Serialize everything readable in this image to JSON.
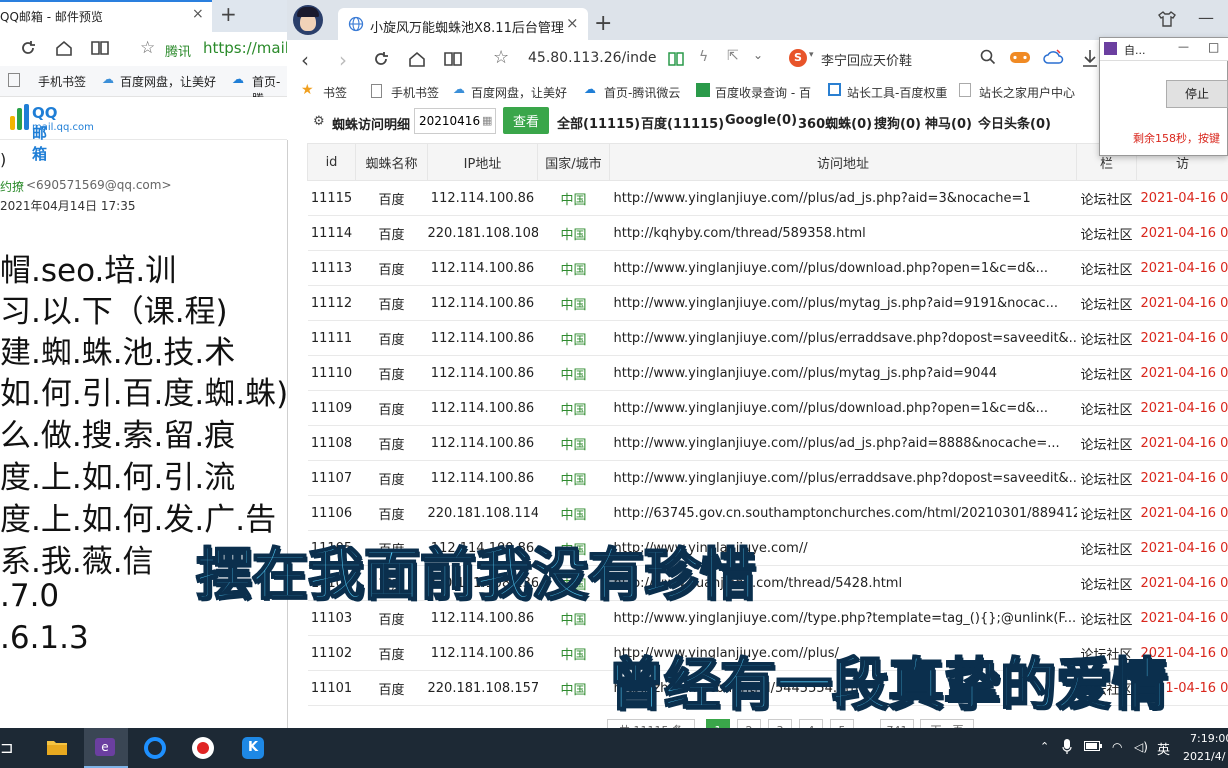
{
  "left_browser": {
    "tab_title": "QQ邮箱 - 邮件预览",
    "tab_close": "×",
    "new_tab": "+",
    "address_site": "腾讯",
    "address_url": "https://mail.q",
    "bookmarks": [
      "手机书签",
      "百度网盘，让美好",
      "首页-腾"
    ],
    "mail_logo_text": "QQ邮箱",
    "mail_logo_domain": "mail.qq.com",
    "sender_paren": ")",
    "sender_name": "约撩",
    "sender_email": "<690571569@qq.com>",
    "sent_time": "2021年04月14日 17:35",
    "body_lines": [
      "帽.seo.培.训",
      "习.以.下（课.程)",
      "建.蜘.蛛.池.技.术",
      "如.何.引.百.度.蜘.蛛)",
      "么.做.搜.索.留.痕",
      "度.上.如.何.引.流",
      "度.上.如.何.发.广.告",
      "系.我.薇.信",
      ".7.0",
      ".6.1.3"
    ]
  },
  "right_browser": {
    "tab_title": "小旋风万能蜘蛛池X8.11后台管理",
    "tab_close": "×",
    "new_tab": "+",
    "address": "45.80.113.26/inde",
    "search_text": "李宁回应天价鞋",
    "bookmarks": [
      "书签",
      "手机书签",
      "百度网盘，让美好",
      "首页-腾讯微云",
      "百度收录查询 - 百",
      "站长工具-百度权重",
      "站长之家用户中心"
    ]
  },
  "toolbar": {
    "title": "蜘蛛访问明细",
    "date_value": "20210416",
    "search_label": "查看",
    "filters": [
      "全部(11115)",
      "百度(11115)",
      "Google(0)",
      "360蜘蛛(0)",
      "搜狗(0)",
      "神马(0)",
      "今日头条(0)"
    ]
  },
  "table": {
    "headers": [
      "id",
      "蜘蛛名称",
      "IP地址",
      "国家/城市",
      "访问地址",
      "栏",
      "访"
    ],
    "rows": [
      {
        "id": "11115",
        "name": "百度",
        "ip": "112.114.100.86",
        "country": "中国",
        "url": "http://www.yinglanjiuye.com//plus/ad_js.php?aid=3&nocache=1",
        "type": "论坛社区",
        "time": "2021-04-16 07"
      },
      {
        "id": "11114",
        "name": "百度",
        "ip": "220.181.108.108",
        "country": "中国",
        "url": "http://kqhyby.com/thread/589358.html",
        "type": "论坛社区",
        "time": "2021-04-16 07"
      },
      {
        "id": "11113",
        "name": "百度",
        "ip": "112.114.100.86",
        "country": "中国",
        "url": "http://www.yinglanjiuye.com//plus/download.php?open=1&c=d&...",
        "type": "论坛社区",
        "time": "2021-04-16 07"
      },
      {
        "id": "11112",
        "name": "百度",
        "ip": "112.114.100.86",
        "country": "中国",
        "url": "http://www.yinglanjiuye.com//plus/mytag_js.php?aid=9191&nocac...",
        "type": "论坛社区",
        "time": "2021-04-16 07"
      },
      {
        "id": "11111",
        "name": "百度",
        "ip": "112.114.100.86",
        "country": "中国",
        "url": "http://www.yinglanjiuye.com//plus/erraddsave.php?dopost=saveedit&...",
        "type": "论坛社区",
        "time": "2021-04-16 07"
      },
      {
        "id": "11110",
        "name": "百度",
        "ip": "112.114.100.86",
        "country": "中国",
        "url": "http://www.yinglanjiuye.com//plus/mytag_js.php?aid=9044",
        "type": "论坛社区",
        "time": "2021-04-16 07"
      },
      {
        "id": "11109",
        "name": "百度",
        "ip": "112.114.100.86",
        "country": "中国",
        "url": "http://www.yinglanjiuye.com//plus/download.php?open=1&c=d&...",
        "type": "论坛社区",
        "time": "2021-04-16 07"
      },
      {
        "id": "11108",
        "name": "百度",
        "ip": "112.114.100.86",
        "country": "中国",
        "url": "http://www.yinglanjiuye.com//plus/ad_js.php?aid=8888&nocache=...",
        "type": "论坛社区",
        "time": "2021-04-16 07"
      },
      {
        "id": "11107",
        "name": "百度",
        "ip": "112.114.100.86",
        "country": "中国",
        "url": "http://www.yinglanjiuye.com//plus/erraddsave.php?dopost=saveedit&...",
        "type": "论坛社区",
        "time": "2021-04-16 07"
      },
      {
        "id": "11106",
        "name": "百度",
        "ip": "220.181.108.114",
        "country": "中国",
        "url": "http://63745.gov.cn.southamptonchurches.com/html/20210301/889412...",
        "type": "论坛社区",
        "time": "2021-04-16 07"
      },
      {
        "id": "11105",
        "name": "百度",
        "ip": "112.114.100.86",
        "country": "中国",
        "url": "http://www.yinglanjiuye.com//",
        "type": "论坛社区",
        "time": "2021-04-16 07"
      },
      {
        "id": "11104",
        "name": "百度",
        "ip": "220.181.108.136",
        "country": "中国",
        "url": "http://www.xuanjiang.com/thread/5428.html",
        "type": "论坛社区",
        "time": "2021-04-16 07"
      },
      {
        "id": "11103",
        "name": "百度",
        "ip": "112.114.100.86",
        "country": "中国",
        "url": "http://www.yinglanjiuye.com//type.php?template=tag_(){};@unlink(F...",
        "type": "论坛社区",
        "time": "2021-04-16 07"
      },
      {
        "id": "11102",
        "name": "百度",
        "ip": "112.114.100.86",
        "country": "中国",
        "url": "http://www.yinglanjiuye.com//plus/",
        "type": "论坛社区",
        "time": "2021-04-16 07"
      },
      {
        "id": "11101",
        "name": "百度",
        "ip": "220.181.108.157",
        "country": "中国",
        "url": "http://zhiheng.com/html/5445554.html",
        "type": "论坛社区",
        "time": "2021-04-16 07"
      }
    ]
  },
  "pager": {
    "total": "共 11115 条",
    "pages": [
      "1",
      "2",
      "3",
      "4",
      "5"
    ],
    "ellipsis": "...",
    "last": "741",
    "next": "下一页"
  },
  "popup": {
    "title": "自...",
    "minimize": "—",
    "maximize": "□",
    "stop_label": "停止",
    "countdown": "剩余158秒，按键"
  },
  "captions": {
    "line1": "摆在我面前我没有珍惜",
    "line2": "曾经有一段真挚的爱情"
  },
  "taskbar": {
    "ime": "英",
    "time": "7:19:00",
    "date": "2021/4/"
  },
  "colors": {
    "accent_green": "#3aa64a",
    "time_red": "#d9261c",
    "country_green": "#2e8b2e",
    "caption_fill": "#4ec4f0"
  }
}
